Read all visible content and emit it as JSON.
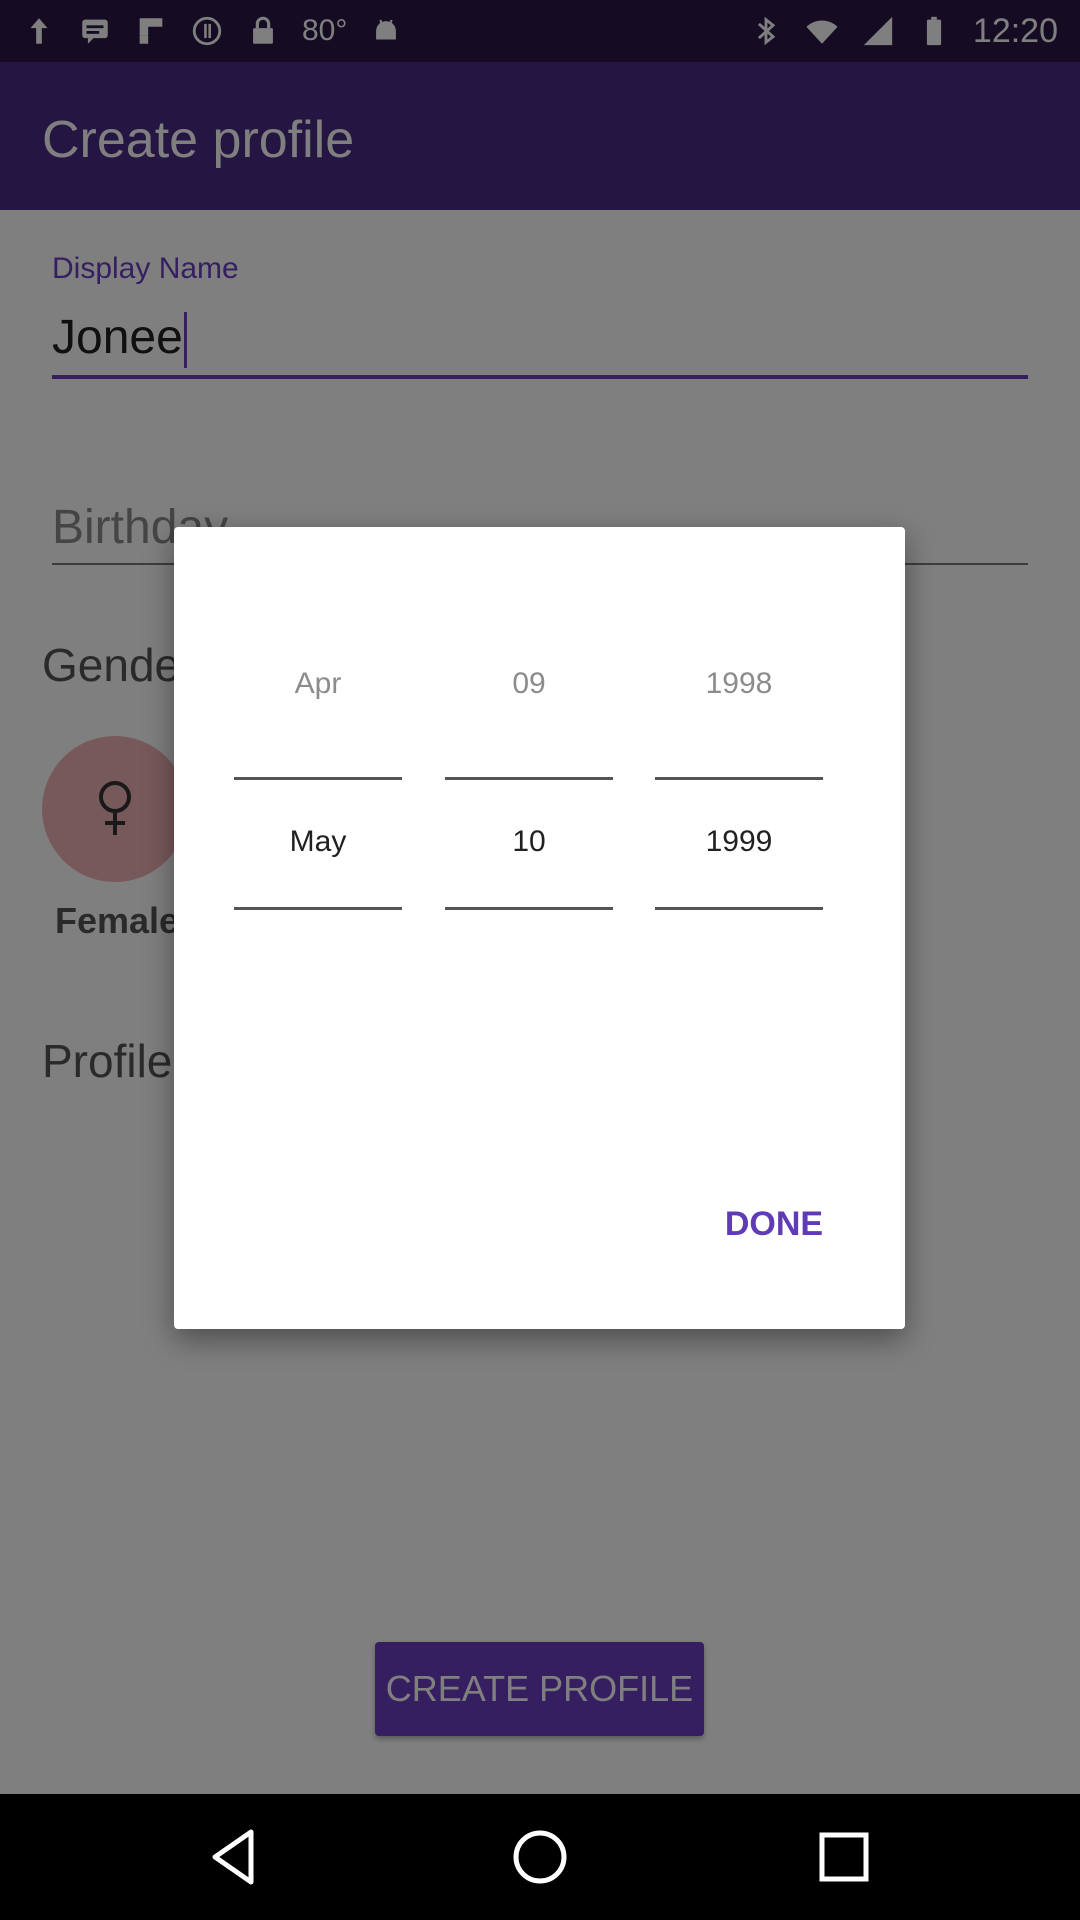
{
  "status_bar": {
    "temperature": "80°",
    "time": "12:20",
    "icons": [
      "arrow-up-icon",
      "message-icon",
      "flipboard-icon",
      "hotspot-icon",
      "lock-icon",
      "android-icon",
      "bluetooth-icon",
      "wifi-icon",
      "signal-icon",
      "battery-icon"
    ]
  },
  "app_bar": {
    "title": "Create profile"
  },
  "form": {
    "display_name_label": "Display Name",
    "display_name_value": "Jonee",
    "birthday_placeholder": "Birthday",
    "gender_section": "Gende",
    "gender_female_label": "Female",
    "profile_section": "Profile"
  },
  "create_button_label": "CREATE PROFILE",
  "date_picker": {
    "month": {
      "previous": "Apr",
      "selected": "May"
    },
    "day": {
      "previous": "09",
      "selected": "10"
    },
    "year": {
      "previous": "1998",
      "selected": "1999"
    },
    "done_label": "DONE"
  },
  "nav_bar": {
    "icons": [
      "back-icon",
      "home-icon",
      "recents-icon"
    ]
  },
  "colors": {
    "app_bar": "#4a2a84",
    "accent": "#6a3fc2",
    "done_text": "#5f3cb5",
    "gender_female_bg": "#f1b2b6"
  }
}
